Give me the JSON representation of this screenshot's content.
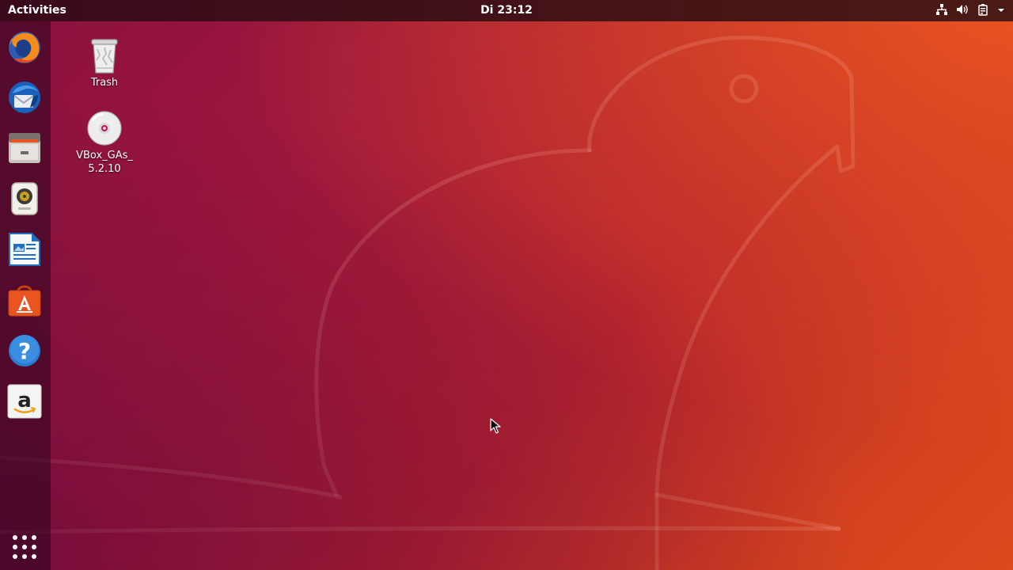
{
  "topbar": {
    "activities_label": "Activities",
    "clock": "Di 23:12"
  },
  "tray": {
    "icons": [
      "network-icon",
      "volume-icon",
      "battery-icon",
      "menu-arrow-icon"
    ]
  },
  "dock": {
    "items": [
      {
        "icon": "firefox-icon"
      },
      {
        "icon": "thunderbird-icon"
      },
      {
        "icon": "files-icon"
      },
      {
        "icon": "rhythmbox-icon"
      },
      {
        "icon": "libreoffice-writer-icon"
      },
      {
        "icon": "ubuntu-software-icon"
      },
      {
        "icon": "help-icon"
      },
      {
        "icon": "amazon-icon"
      }
    ],
    "show_apps_icon": "show-applications-icon"
  },
  "desktop": {
    "icons": [
      {
        "label": "Trash",
        "icon": "trash-icon"
      },
      {
        "label_line1": "VBox_GAs_",
        "label_line2": "5.2.10",
        "icon": "optical-disc-icon"
      }
    ]
  },
  "colors": {
    "accent": "#e95420",
    "topbar": "#3a0a1c"
  }
}
